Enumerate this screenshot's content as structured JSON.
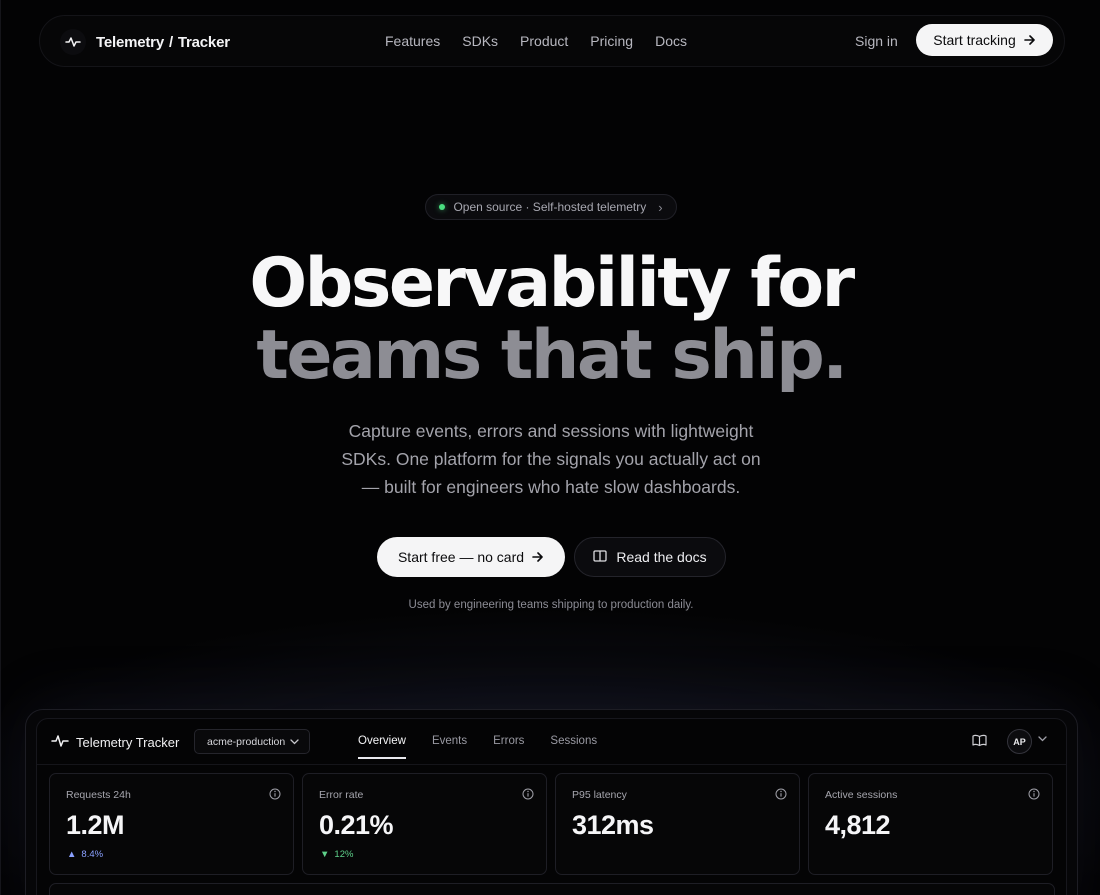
{
  "nav": {
    "brand_name": "Telemetry",
    "brand_sep": "/",
    "brand_product": "Tracker",
    "links": [
      "Features",
      "SDKs",
      "Product",
      "Pricing",
      "Docs"
    ],
    "sign_in": "Sign in",
    "cta": "Start tracking"
  },
  "hero": {
    "badge": "Open source · Self-hosted telemetry",
    "title_line1": "Observability for",
    "title_line2": "teams that ship.",
    "subtitle": "Capture events, errors and sessions with lightweight SDKs. One platform for the signals you actually act on — built for engineers who hate slow dashboards.",
    "primary_cta": "Start free — no card",
    "secondary_cta": "Read the docs",
    "used_by": "Used by engineering teams shipping to production daily."
  },
  "dashboard": {
    "brand": "Telemetry Tracker",
    "environment": "acme-production",
    "tabs": [
      "Overview",
      "Events",
      "Errors",
      "Sessions"
    ],
    "active_tab": "Overview",
    "avatar_initials": "AP",
    "metrics": [
      {
        "label": "Requests 24h",
        "value": "1.2M",
        "delta": "8.4%",
        "direction": "up"
      },
      {
        "label": "Error rate",
        "value": "0.21%",
        "delta": "12%",
        "direction": "down"
      },
      {
        "label": "P95 latency",
        "value": "312ms",
        "delta": "",
        "direction": "none"
      },
      {
        "label": "Active sessions",
        "value": "4,812",
        "delta": "",
        "direction": "none"
      }
    ]
  },
  "colors": {
    "background": "#030304",
    "accent_up": "#8aa0ff",
    "accent_down": "#5ed08a",
    "status_dot": "#4ade80"
  }
}
